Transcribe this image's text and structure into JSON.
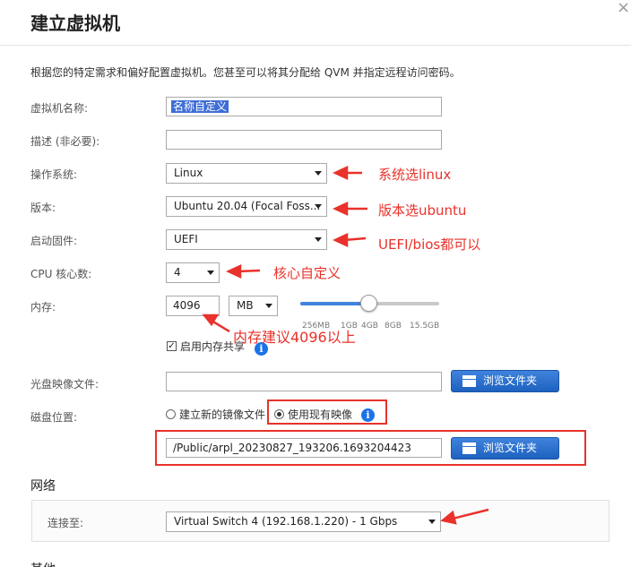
{
  "dialog": {
    "title": "建立虚拟机",
    "close_symbol": "×",
    "intro": "根据您的特定需求和偏好配置虚拟机。您甚至可以将其分配给 QVM 并指定远程访问密码。"
  },
  "form": {
    "vm_name": {
      "label": "虚拟机名称:",
      "value": "名称自定义"
    },
    "description": {
      "label": "描述 (非必要):",
      "value": ""
    },
    "os": {
      "label": "操作系统:",
      "value": "Linux"
    },
    "version": {
      "label": "版本:",
      "value": "Ubuntu 20.04 (Focal Foss..."
    },
    "firmware": {
      "label": "启动固件:",
      "value": "UEFI"
    },
    "cpu": {
      "label": "CPU 核心数:",
      "value": "4"
    },
    "memory": {
      "label": "内存:",
      "value": "4096",
      "unit": "MB",
      "slider_level_gb": 4,
      "ticks": [
        "256MB",
        "1GB",
        "4GB",
        "8GB",
        "15.5GB"
      ],
      "share_label": "启用内存共享",
      "share_checked": true
    },
    "iso": {
      "label": "光盘映像文件:",
      "value": "",
      "browse_label": "浏览文件夹"
    },
    "disk": {
      "label": "磁盘位置:",
      "option_new": "建立新的镜像文件",
      "option_existing": "使用现有映像",
      "selected": "existing",
      "path": "/Public/arpl_20230827_193206.1693204423",
      "browse_label": "浏览文件夹"
    }
  },
  "network": {
    "section_title": "网络",
    "connect_label": "连接至:",
    "value": "Virtual Switch 4 (192.168.1.220) - 1 Gbps"
  },
  "other_section_title": "其他",
  "annotations": {
    "os": "系统选linux",
    "version": "版本选ubuntu",
    "firmware": "UEFI/bios都可以",
    "cpu": "核心自定义",
    "memory": "内存建议4096以上"
  },
  "colors": {
    "annotation": "#e8322b",
    "button": "#2a6fcf",
    "info": "#1a73e8"
  }
}
